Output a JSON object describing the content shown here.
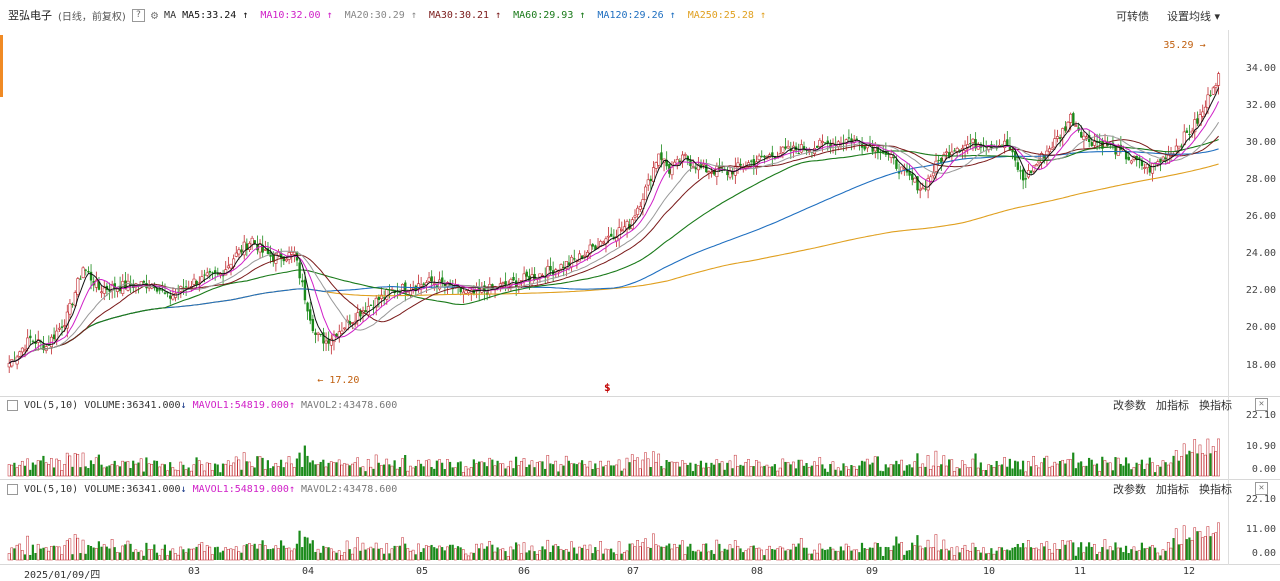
{
  "header": {
    "stock_name": "翌弘电子",
    "period": "(日线，前复权)",
    "help": "?",
    "ma_label": "MA",
    "ma_lines": [
      {
        "label": "MA5:33.24",
        "color": "#111111",
        "arrow": "↑"
      },
      {
        "label": "MA10:32.00",
        "color": "#d020c8",
        "arrow": "↑"
      },
      {
        "label": "MA20:30.29",
        "color": "#888888",
        "arrow": "↑"
      },
      {
        "label": "MA30:30.21",
        "color": "#7a1a1a",
        "arrow": "↑"
      },
      {
        "label": "MA60:29.93",
        "color": "#1a7a1a",
        "arrow": "↑"
      },
      {
        "label": "MA120:29.26",
        "color": "#1f6fc0",
        "arrow": "↑"
      },
      {
        "label": "MA250:25.28",
        "color": "#e0a020",
        "arrow": "↑"
      }
    ],
    "right_links": [
      "可转债",
      "设置均线 ▾"
    ]
  },
  "price_axis": [
    "34.00",
    "32.00",
    "30.00",
    "28.00",
    "26.00",
    "24.00",
    "22.00",
    "20.00",
    "18.00"
  ],
  "annotations": {
    "high": "35.29",
    "low": "17.20",
    "marker": "$"
  },
  "vol_panel": {
    "checkbox": "",
    "title": "VOL(5,10)",
    "volume": "VOLUME:36341.000",
    "volume_arrow": "↓",
    "mavol1": "MAVOL1:54819.000",
    "mavol1_arrow": "↑",
    "mavol2": "MAVOL2:43478.600",
    "links": [
      "改参数",
      "加指标",
      "换指标"
    ],
    "close": "✕",
    "axis": [
      "22.10",
      "10.90",
      "0.00"
    ]
  },
  "vol_panel2": {
    "checkbox": "",
    "title": "VOL(5,10)",
    "volume": "VOLUME:36341.000",
    "volume_arrow": "↓",
    "mavol1": "MAVOL1:54819.000",
    "mavol1_arrow": "↑",
    "mavol2": "MAVOL2:43478.600",
    "links": [
      "改参数",
      "加指标",
      "换指标"
    ],
    "close": "✕",
    "axis": [
      "22.10",
      "11.00",
      "0.00"
    ]
  },
  "x_axis": [
    "2025/01/09/四",
    "03",
    "04",
    "05",
    "06",
    "07",
    "08",
    "09",
    "10",
    "11",
    "12"
  ],
  "colors": {
    "up": "#c0272d",
    "down": "#1a8a1a",
    "ma250": "#e0a020",
    "ma120": "#1f6fc0",
    "ma60": "#1a7a1a",
    "ma30": "#7a1a1a",
    "ma20": "#999999",
    "ma10": "#d020c8",
    "ma5": "#111111"
  }
}
